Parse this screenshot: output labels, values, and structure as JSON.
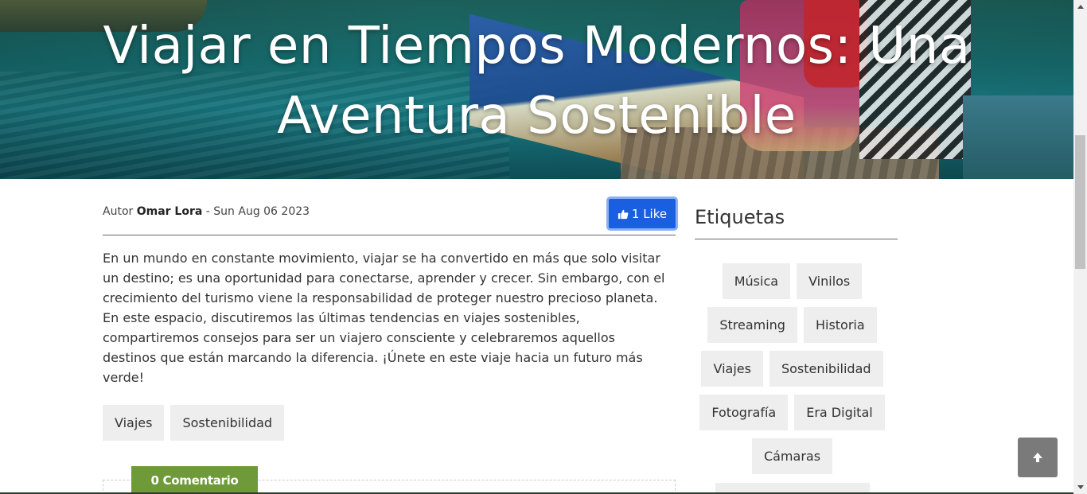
{
  "hero": {
    "title": "Viajar en Tiempos Modernos: Una Aventura Sostenible"
  },
  "post": {
    "author_prefix": "Autor",
    "author_name": "Omar Lora",
    "date_separator": " - ",
    "date": "Sun Aug 06 2023",
    "like_label": "1 Like",
    "body": "En un mundo en constante movimiento, viajar se ha convertido en más que solo visitar un destino; es una oportunidad para conectarse, aprender y crecer. Sin embargo, con el crecimiento del turismo viene la responsabilidad de proteger nuestro precioso planeta. En este espacio, discutiremos las últimas tendencias en viajes sostenibles, compartiremos consejos para ser un viajero consciente y celebraremos aquellos destinos que están marcando la diferencia. ¡Únete en este viaje hacia un futuro más verde!",
    "tags": [
      "Viajes",
      "Sostenibilidad"
    ],
    "comments_label": "0 Comentario"
  },
  "sidebar": {
    "title": "Etiquetas",
    "tag_rows": [
      [
        "Música",
        "Vinilos"
      ],
      [
        "Streaming",
        "Historia"
      ],
      [
        "Viajes",
        "Sostenibilidad"
      ],
      [
        "Fotografía",
        "Era Digital"
      ],
      [
        "Cámaras"
      ]
    ]
  },
  "icons": {
    "like": "thumbs-up-icon",
    "to_top": "arrow-up-icon"
  },
  "colors": {
    "like_button": "#1a5fe0",
    "comments_tab": "#6f9a3a",
    "tag_bg": "#eeeeee",
    "to_top_bg": "#7a7a7a"
  }
}
